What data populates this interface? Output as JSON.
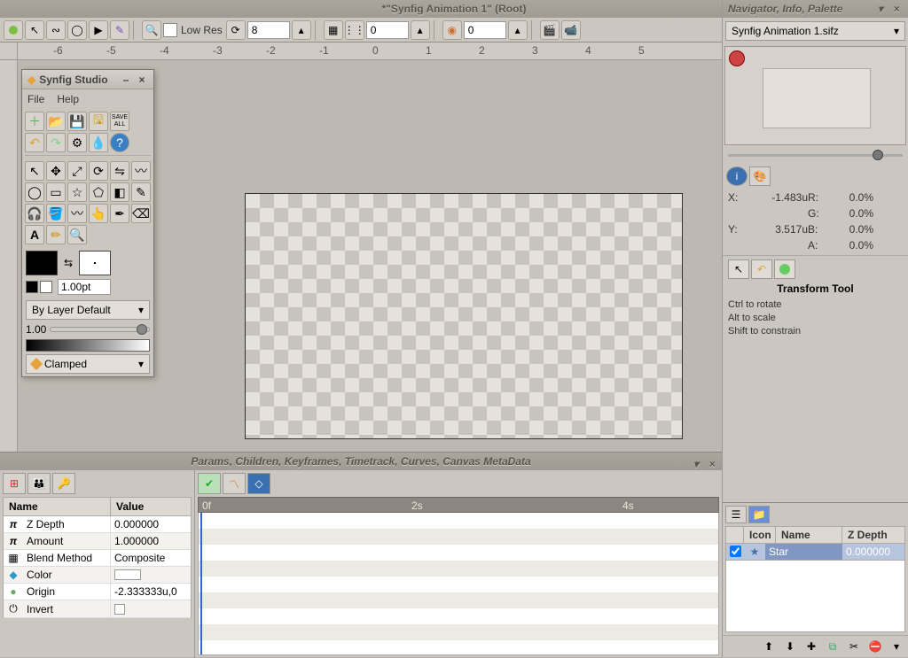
{
  "window": {
    "title": "*\"Synfig Animation 1\" (Root)"
  },
  "toolbar": {
    "lowres_label": "Low Res",
    "quality": "8",
    "zero1": "0",
    "zero2": "0"
  },
  "toolbox": {
    "title": "Synfig Studio",
    "menu": {
      "file": "File",
      "help": "Help"
    },
    "stroke": "1.00pt",
    "blend_combo": "By Layer Default",
    "opacity": "1.00",
    "clamp": "Clamped",
    "saveall": "SAVE\nALL"
  },
  "right": {
    "panelTitle": "Navigator, Info, Palette",
    "fileTab": "Synfig Animation 1.sifz",
    "info": {
      "x_label": "X:",
      "x_val": "-1.483u",
      "y_label": "Y:",
      "y_val": "3.517u",
      "r_label": "R:",
      "r_val": "0.0%",
      "g_label": "G:",
      "g_val": "0.0%",
      "b_label": "B:",
      "b_val": "0.0%",
      "a_label": "A:",
      "a_val": "0.0%"
    },
    "toolhelp": {
      "title": "Transform Tool",
      "l1": "Ctrl to rotate",
      "l2": "Alt to scale",
      "l3": "Shift to constrain"
    },
    "layers": {
      "head_icon": "Icon",
      "head_name": "Name",
      "head_z": "Z Depth",
      "row": {
        "name": "Star",
        "z": "0.000000"
      }
    }
  },
  "bottom": {
    "title": "Params, Children, Keyframes, Timetrack, Curves, Canvas MetaData",
    "head_name": "Name",
    "head_value": "Value",
    "rows": [
      {
        "icon": "π",
        "name": "Z Depth",
        "value": "0.000000"
      },
      {
        "icon": "π",
        "name": "Amount",
        "value": "1.000000"
      },
      {
        "icon": "▦",
        "name": "Blend Method",
        "value": "Composite"
      },
      {
        "icon": "◆",
        "name": "Color",
        "value": ""
      },
      {
        "icon": "●",
        "name": "Origin",
        "value": "-2.333333u,0"
      },
      {
        "icon": "⏻",
        "name": "Invert",
        "value": ""
      }
    ],
    "time": {
      "t0": "0f",
      "t1": "2s",
      "t2": "4s"
    }
  }
}
